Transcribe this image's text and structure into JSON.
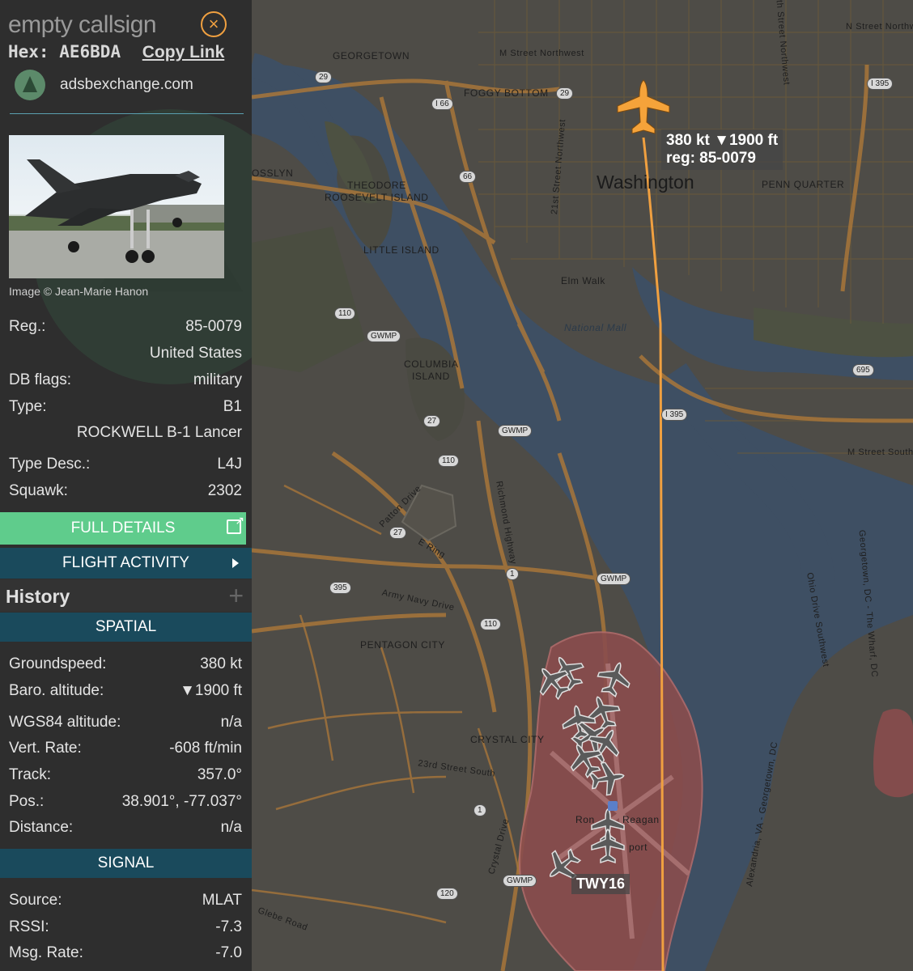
{
  "header": {
    "callsign": "empty callsign",
    "hex_label": "Hex:",
    "hex_value": "AE6BDA",
    "copy_link": "Copy Link",
    "site_name": "adsbexchange.com"
  },
  "photo": {
    "credit": "Image © Jean-Marie Hanon"
  },
  "aircraft": {
    "reg_label": "Reg.:",
    "reg_value": "85-0079",
    "country": "United States",
    "db_flags_label": "DB flags:",
    "db_flags_value": "military",
    "type_label": "Type:",
    "type_value": "B1",
    "type_full": "ROCKWELL B-1 Lancer",
    "type_desc_label": "Type Desc.:",
    "type_desc_value": "L4J",
    "squawk_label": "Squawk:",
    "squawk_value": "2302"
  },
  "buttons": {
    "full_details": "FULL DETAILS",
    "flight_activity": "FLIGHT ACTIVITY"
  },
  "history": {
    "title": "History",
    "plus": "+"
  },
  "spatial": {
    "title": "SPATIAL",
    "groundspeed_label": "Groundspeed:",
    "groundspeed_value": "380 kt",
    "baro_label": "Baro. altitude:",
    "baro_value": "▼1900 ft",
    "wgs_label": "WGS84 altitude:",
    "wgs_value": "n/a",
    "vert_label": "Vert. Rate:",
    "vert_value": "-608 ft/min",
    "track_label": "Track:",
    "track_value": "357.0°",
    "pos_label": "Pos.:",
    "pos_value": "38.901°, -77.037°",
    "dist_label": "Distance:",
    "dist_value": "n/a"
  },
  "signal": {
    "title": "SIGNAL",
    "source_label": "Source:",
    "source_value": "MLAT",
    "rssi_label": "RSSI:",
    "rssi_value": "-7.3",
    "msg_label": "Msg. Rate:",
    "msg_value": "-7.0"
  },
  "map": {
    "callout_line1": "380 kt ▼1900 ft",
    "callout_line2": "reg: 85-0079",
    "twy_label": "TWY16",
    "labels": {
      "georgetown": "GEORGETOWN",
      "foggy_bottom": "FOGGY BOTTOM",
      "rosslyn": "OSSLYN",
      "theodore": "THEODORE",
      "roosevelt_island": "ROOSEVELT ISLAND",
      "washington": "Washington",
      "penn_quarter": "PENN QUARTER",
      "little_island": "LITTLE ISLAND",
      "national_mall": "National Mall",
      "elm_walk": "Elm Walk",
      "columbia": "COLUMBIA",
      "island": "ISLAND",
      "pentagon_city": "PENTAGON CITY",
      "crystal_city": "CRYSTAL CITY",
      "m_street_nw": "M Street Northwest",
      "n_street_nw": "N Street Northwest",
      "m_street_sw": "M Street South",
      "army_navy": "Army Navy Drive",
      "e_ring": "E Ring",
      "patton": "Patton Drive",
      "richmond": "Richmond Highway",
      "twenty_third_st": "23rd Street South",
      "crystal_dr": "Crystal Drive",
      "ohio_drive": "Ohio Drive Southwest",
      "georgetown_dc": "Georgetown, DC - The Wharf, DC",
      "alexandria": "Alexandria, VA - Georgetown, DC",
      "reagan": "Reagan",
      "ronald": "Ron",
      "port": "port",
      "glebe": "Glebe Road",
      "twenty_first": "21st Street Northwest",
      "tenth_st": "10th Street Northwest",
      "s1": "29",
      "s2": "I 66",
      "s3": "29",
      "s4": "I 395",
      "s5": "66",
      "s6": "110",
      "s7": "GWMP",
      "s8": "27",
      "s9": "GWMP",
      "s10": "110",
      "s11": "27",
      "s12": "395",
      "s13": "1",
      "s14": "GWMP",
      "s15": "110",
      "s16": "1",
      "s17": "GWMP",
      "s18": "120",
      "s19": "I 395",
      "s20": "695"
    }
  }
}
